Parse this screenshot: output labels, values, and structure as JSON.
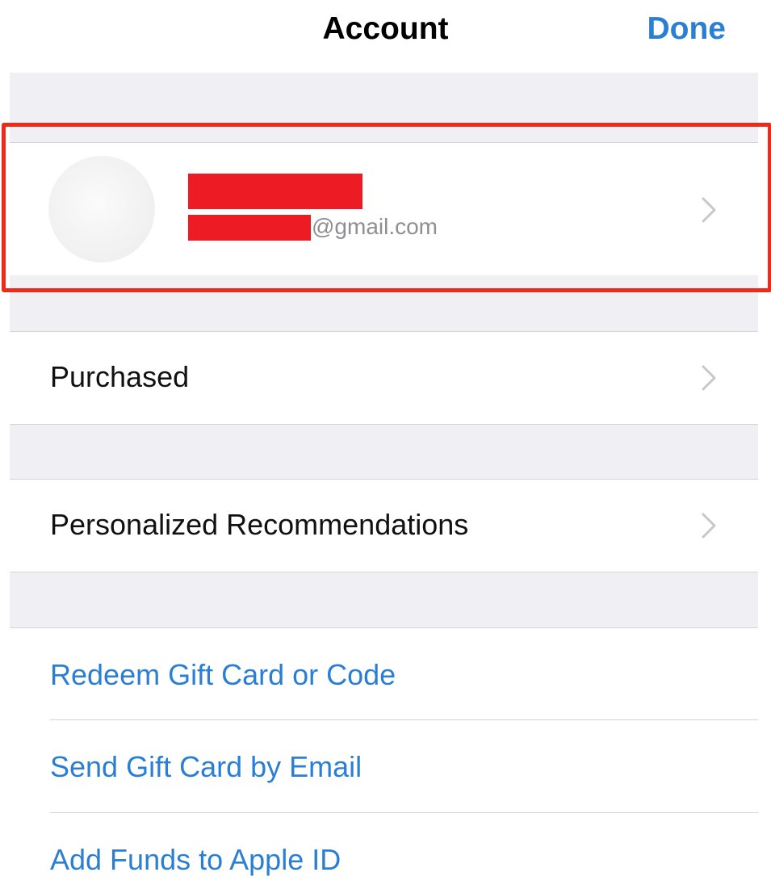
{
  "nav": {
    "title": "Account",
    "done_label": "Done"
  },
  "account": {
    "email_suffix": "@gmail.com",
    "redacted": true
  },
  "rows": {
    "purchased": "Purchased",
    "recommendations": "Personalized Recommendations",
    "redeem": "Redeem Gift Card or Code",
    "send_gift": "Send Gift Card by Email",
    "add_funds": "Add Funds to Apple ID"
  },
  "colors": {
    "accent": "#2a7fd4",
    "highlight": "#ee2a1b",
    "redaction": "#ed1c24",
    "group_background": "#efeff4"
  },
  "icons": {
    "disclosure": "chevron-right-icon"
  }
}
